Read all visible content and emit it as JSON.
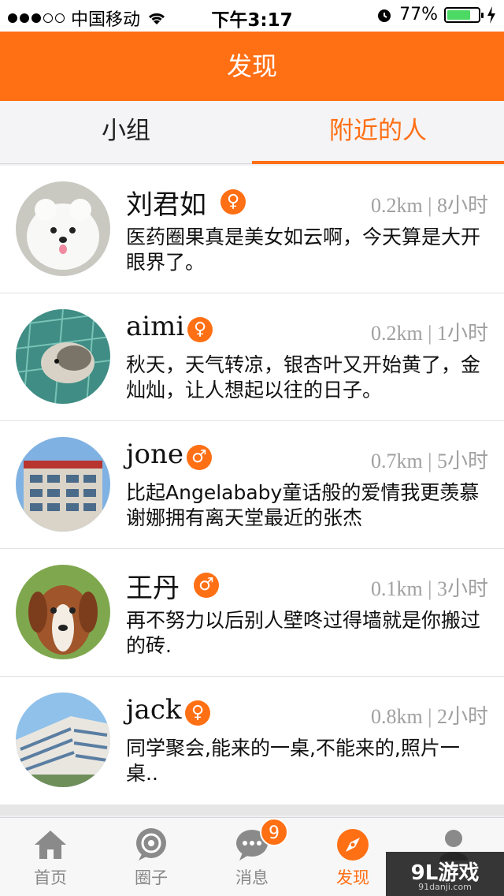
{
  "status_bar": {
    "carrier": "中国移动",
    "time": "下午3:17",
    "battery": "77%",
    "battery_level": 0.77,
    "signal_bars": 3
  },
  "navbar": {
    "title": "发现"
  },
  "tabs": [
    {
      "label": "小组",
      "active": false
    },
    {
      "label": "附近的人",
      "active": true
    }
  ],
  "people": [
    {
      "name": "刘君如",
      "gender": "female",
      "gender_icon": "female-icon",
      "distance": "0.2km",
      "time_ago": "8小时",
      "message": "医药圈果真是美女如云啊，今天算是大开眼界了。",
      "avatar": "white-dog"
    },
    {
      "name": "aimi",
      "gender": "female",
      "gender_icon": "female-icon",
      "distance": "0.2km",
      "time_ago": "1小时",
      "message": "秋天，天气转凉，银杏叶又开始黄了，金灿灿，让人想起以往的日子。",
      "avatar": "hamster"
    },
    {
      "name": "jone",
      "gender": "male",
      "gender_icon": "male-icon",
      "distance": "0.7km",
      "time_ago": "5小时",
      "message": "比起Angelababy童话般的爱情我更羡慕谢娜拥有离天堂最近的张杰",
      "avatar": "hospital-building"
    },
    {
      "name": "王丹",
      "gender": "male",
      "gender_icon": "male-icon",
      "distance": "0.1km",
      "time_ago": "3小时",
      "message": "再不努力以后别人壁咚过得墙就是你搬过的砖.",
      "avatar": "brown-dog"
    },
    {
      "name": "jack",
      "gender": "female",
      "gender_icon": "female-icon",
      "distance": "0.8km",
      "time_ago": "2小时",
      "message": "同学聚会,能来的一桌,不能来的,照片一桌..",
      "avatar": "hospital-building-2"
    }
  ],
  "tabbar": [
    {
      "label": "首页",
      "icon": "home-icon",
      "active": false
    },
    {
      "label": "圈子",
      "icon": "circle-icon",
      "active": false
    },
    {
      "label": "消息",
      "icon": "chat-icon",
      "active": false,
      "badge": "9"
    },
    {
      "label": "发现",
      "icon": "compass-icon",
      "active": true
    },
    {
      "label": "",
      "icon": "person-icon",
      "active": false
    }
  ],
  "watermark": {
    "main": "9L游戏",
    "sub": "91danji.com"
  },
  "colors": {
    "accent": "#ff6f14",
    "text": "#111111",
    "meta": "#a0a0a0"
  }
}
